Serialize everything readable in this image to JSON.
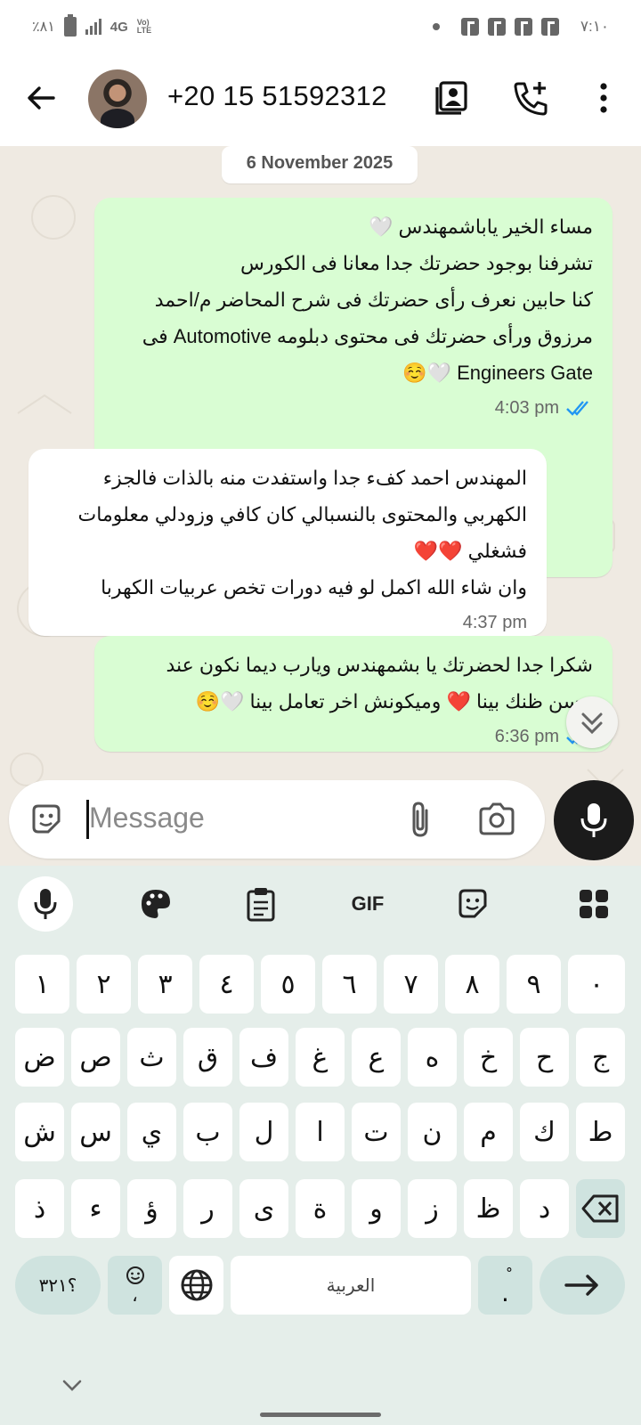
{
  "status_bar": {
    "battery": "٪٨١",
    "network": "4G",
    "volte": "Vo) LTE",
    "time": "٧:١٠"
  },
  "header": {
    "contact_name": "+20 15 51592312",
    "icons": [
      "back-arrow-icon",
      "avatar",
      "contact-card-icon",
      "add-call-icon",
      "more-vert-icon"
    ]
  },
  "chat": {
    "date": "6 November 2025",
    "messages": [
      {
        "direction": "out",
        "lines": [
          "مساء الخير ياباشمهندس 🤍",
          "تشرفنا بوجود حضرتك جدا معانا فى الكورس",
          "كنا حابين نعرف رأى حضرتك فى شرح المحاضر م/احمد",
          "مرزوق ورأى حضرتك فى محتوى دبلومه Automotive فى",
          "Engineers Gate 🤍☺️"
        ],
        "time": "4:03 pm"
      },
      {
        "direction": "in",
        "lines": [
          "المهندس احمد كفء جدا واستفدت منه بالذات فالجزء",
          "الكهربي والمحتوى بالنسبالي كان كافي وزودلي معلومات",
          "فشغلي ❤️❤️",
          "وان شاء الله اكمل لو فيه دورات تخص عربيات الكهربا"
        ],
        "time": "4:37 pm"
      },
      {
        "direction": "out",
        "lines": [
          "شكرا جدا لحضرتك يا بشمهندس ويارب ديما نكون عند",
          "حسن ظنك بينا ❤️ وميكونش اخر تعامل بينا 🤍☺️"
        ],
        "time": "6:36 pm"
      }
    ]
  },
  "composer": {
    "placeholder": "Message"
  },
  "keyboard": {
    "toolbar": [
      "mic-icon",
      "palette-icon",
      "clipboard-icon",
      "GIF",
      "sticker-icon",
      "apps-grid-icon"
    ],
    "row1": [
      "١",
      "٢",
      "٣",
      "٤",
      "٥",
      "٦",
      "٧",
      "٨",
      "٩",
      "٠"
    ],
    "row2": [
      "ض",
      "ص",
      "ث",
      "ق",
      "ف",
      "غ",
      "ع",
      "ه",
      "خ",
      "ح",
      "ج"
    ],
    "row3": [
      "ش",
      "س",
      "ي",
      "ب",
      "ل",
      "ا",
      "ت",
      "ن",
      "م",
      "ك",
      "ط"
    ],
    "row4": [
      "ذ",
      "ء",
      "ؤ",
      "ر",
      "ى",
      "ة",
      "و",
      "ز",
      "ظ",
      "د"
    ],
    "symbols_key": "؟٣٢١",
    "emoji_key_sub": "،",
    "space_label": "العربية",
    "period_key": ".",
    "period_key_sup": "ْ"
  }
}
